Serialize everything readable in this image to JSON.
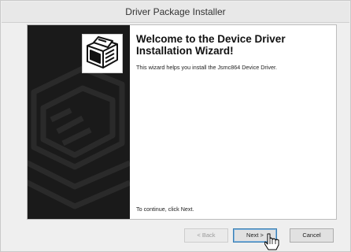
{
  "window": {
    "title": "Driver Package Installer"
  },
  "wizard": {
    "heading": "Welcome to the Device Driver Installation Wizard!",
    "description": "This wizard helps you install the Jsmc864 Device Driver.",
    "continue_text": "To continue, click Next."
  },
  "buttons": {
    "back_label": "< Back",
    "next_label": "Next >",
    "cancel_label": "Cancel"
  },
  "icons": {
    "logo": "device-driver-package-icon",
    "cursor": "hand-pointer-cursor"
  },
  "colors": {
    "sidebar": "#1a1a1a",
    "default_button_border": "#3c7fb1"
  }
}
